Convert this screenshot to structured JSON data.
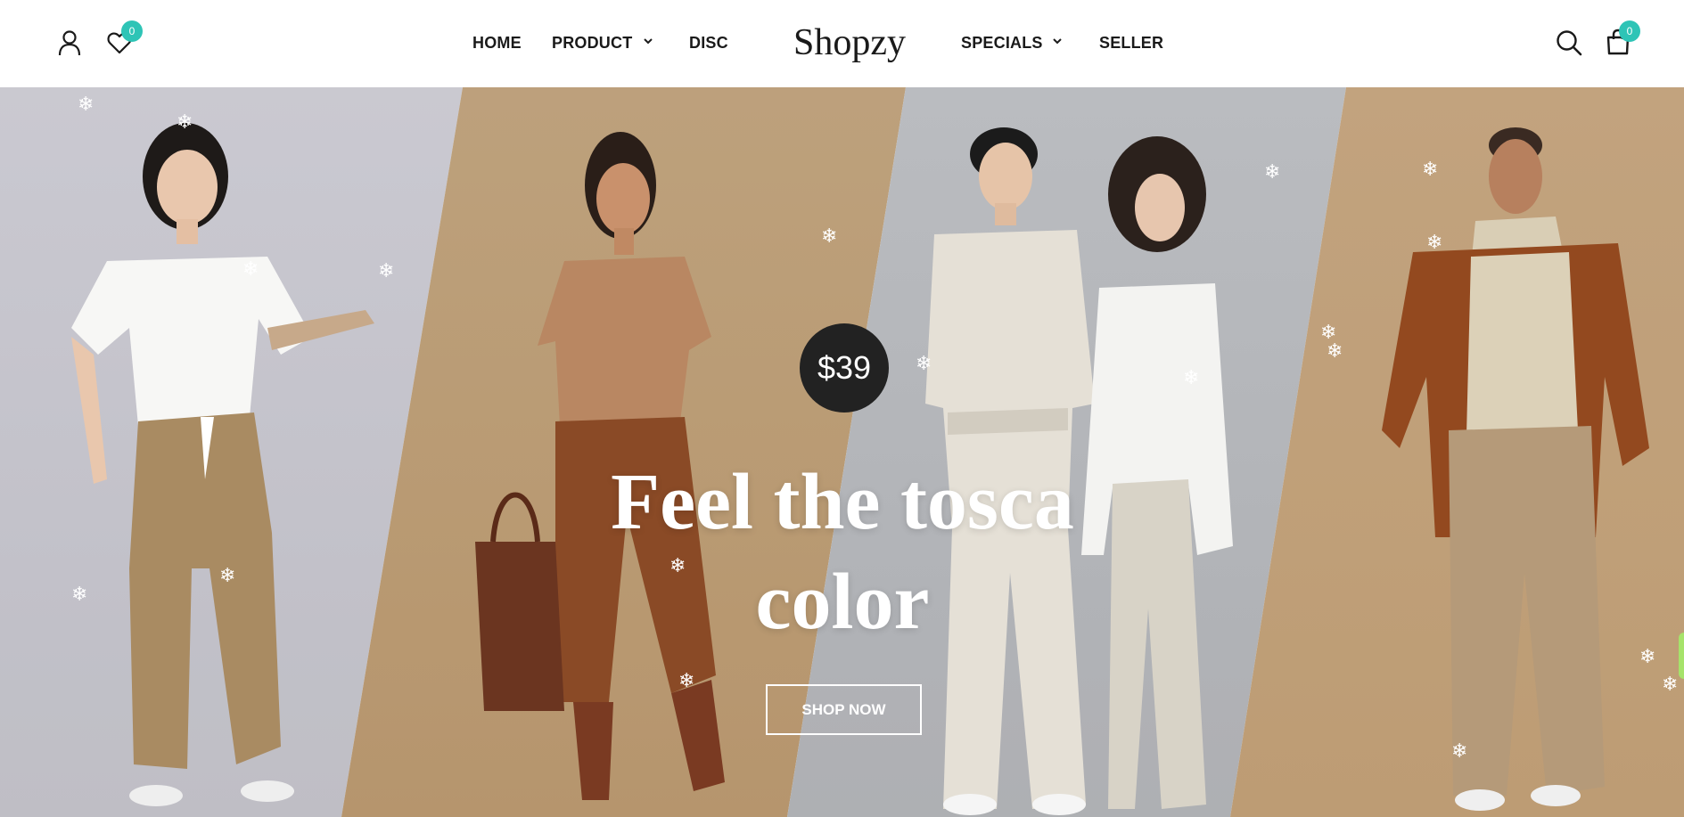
{
  "header": {
    "logo": "Shopzy",
    "wishlist_count": "0",
    "cart_count": "0",
    "icons": {
      "account": "user-icon",
      "wishlist": "heart-icon",
      "search": "search-icon",
      "cart": "shopping-bag-icon",
      "dropdown": "chevron-down-icon"
    },
    "nav": {
      "home": "HOME",
      "product": "PRODUCT",
      "disc": "DISC",
      "specials": "SPECIALS",
      "seller": "SELLER"
    }
  },
  "hero": {
    "price": "$39",
    "headline_line1": "Feel the tosca",
    "headline_line2": "color",
    "cta": "SHOP NOW"
  },
  "decor": {
    "snowflake": "❄"
  },
  "colors": {
    "badge": "#2ec4b6",
    "price_bg": "#222222",
    "panel_lavender": "#d7d6de",
    "panel_tan": "#c9ab84",
    "panel_grey": "#c6c8cc",
    "panel_camel": "#cfae86",
    "side_tab": "#a6e36b"
  }
}
